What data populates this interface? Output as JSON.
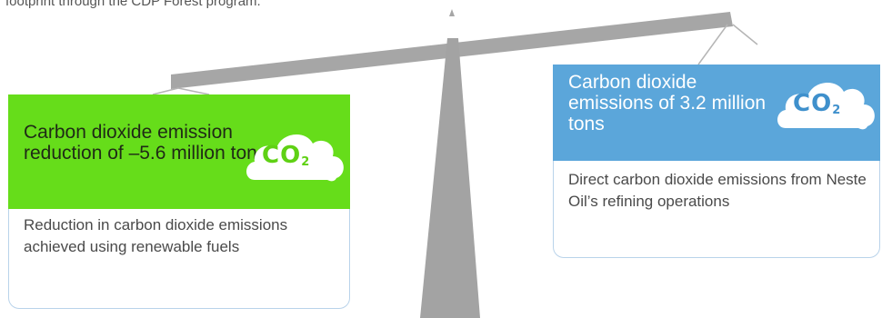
{
  "intro_text": "footprint through the CDP Forest program.",
  "colors": {
    "green": "#66dd1a",
    "blue": "#5ba6da",
    "scale_gray": "#a5a5a5"
  },
  "left_panel": {
    "title": "Carbon dioxide emission reduction of –5.6 million tons",
    "icon": "co2-cloud-icon",
    "co2": "CO",
    "co2_sub": "2",
    "description": "Reduction in carbon dioxide emissions achieved using renewable fuels"
  },
  "right_panel": {
    "title": "Carbon dioxide emissions of 3.2 million tons",
    "icon": "co2-cloud-icon",
    "co2": "CO",
    "co2_sub": "2",
    "description": "Direct carbon dioxide emissions from Neste Oil’s refining operations"
  }
}
